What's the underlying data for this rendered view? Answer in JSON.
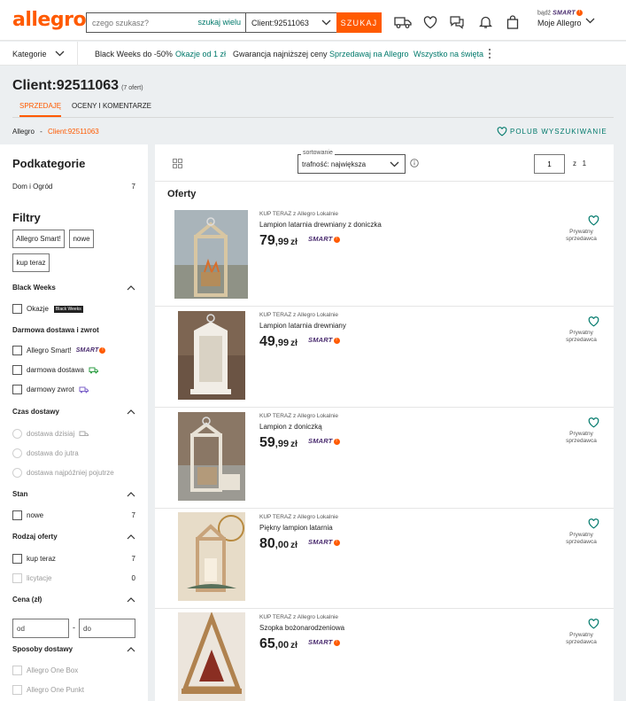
{
  "header": {
    "logo": "allegro",
    "search_placeholder": "czego szukasz?",
    "search_many": "szukaj wielu",
    "search_category": "Client:92511063",
    "search_button": "SZUKAJ",
    "badz": "bądź",
    "smart": "SMART",
    "smart_mark": "!",
    "account": "Moje Allegro"
  },
  "nav": {
    "categories": "Kategorie",
    "links": [
      "Black Weeks do -50%",
      "Okazje od 1 zł",
      "Gwarancja najniższej ceny",
      "Sprzedawaj na Allegro",
      "Wszystko na święta"
    ]
  },
  "page": {
    "title": "Client:92511063",
    "count": "(7 ofert)",
    "tabs": [
      "SPRZEDAJĘ",
      "OCENY I KOMENTARZE"
    ],
    "breadcrumb_root": "Allegro",
    "breadcrumb_sep": "-",
    "breadcrumb_current": "Client:92511063",
    "follow": "POLUB WYSZUKIWANIE"
  },
  "sidebar": {
    "subcategories_title": "Podkategorie",
    "subcategory": {
      "label": "Dom i Ogród",
      "count": "7"
    },
    "filters_title": "Filtry",
    "chips": [
      "Allegro Smart!",
      "nowe",
      "kup teraz"
    ],
    "sections": {
      "black_weeks": "Black Weeks",
      "okazje": "Okazje",
      "okazje_badge": "Black Weeks",
      "free_delivery": "Darmowa dostawa i zwrot",
      "allegro_smart": "Allegro Smart!",
      "darmowa_dostawa": "darmowa dostawa",
      "darmowy_zwrot": "darmowy zwrot",
      "czas_dostawy": "Czas dostawy",
      "dzisiaj": "dostawa dzisiaj",
      "jutro": "dostawa do jutra",
      "pojutrze": "dostawa najpóźniej pojutrze",
      "stan": "Stan",
      "nowe": "nowe",
      "nowe_count": "7",
      "rodzaj": "Rodzaj oferty",
      "kup_teraz": "kup teraz",
      "kup_teraz_count": "7",
      "licytacje": "licytacje",
      "licytacje_count": "0",
      "cena": "Cena (zł)",
      "od": "od",
      "dash": "-",
      "do": "do",
      "sposoby": "Sposoby dostawy",
      "one_box": "Allegro One Box",
      "one_punkt": "Allegro One Punkt"
    }
  },
  "toolbar": {
    "sort_label": "sortowanie",
    "sort_value": "trafność: największa",
    "page": "1",
    "of_label": "z",
    "total_pages": "1"
  },
  "offers_title": "Oferty",
  "offers": [
    {
      "sub": "KUP TERAZ z Allegro Lokalnie",
      "title": "Lampion latarnia drewniany z doniczka",
      "price_int": "79",
      "price_dec": ",99",
      "currency": "zł",
      "smart": "SMART",
      "seller": "Prywatny sprzedawca"
    },
    {
      "sub": "KUP TERAZ z Allegro Lokalnie",
      "title": "Lampion latarnia drewniany",
      "price_int": "49",
      "price_dec": ",99",
      "currency": "zł",
      "smart": "SMART",
      "seller": "Prywatny sprzedawca"
    },
    {
      "sub": "KUP TERAZ z Allegro Lokalnie",
      "title": "Lampion z doniczką",
      "price_int": "59",
      "price_dec": ",99",
      "currency": "zł",
      "smart": "SMART",
      "seller": "Prywatny sprzedawca"
    },
    {
      "sub": "KUP TERAZ z Allegro Lokalnie",
      "title": "Piękny lampion latarnia",
      "price_int": "80",
      "price_dec": ",00",
      "currency": "zł",
      "smart": "SMART",
      "seller": "Prywatny sprzedawca"
    },
    {
      "sub": "KUP TERAZ z Allegro Lokalnie",
      "title": "Szopka bożonarodzeniowa",
      "price_int": "65",
      "price_dec": ",00",
      "currency": "zł",
      "smart": "SMART",
      "seller": "Prywatny sprzedawca"
    }
  ],
  "colors": {
    "brand": "#ff5a00",
    "link": "#00796b",
    "smart": "#4a2c6f"
  }
}
